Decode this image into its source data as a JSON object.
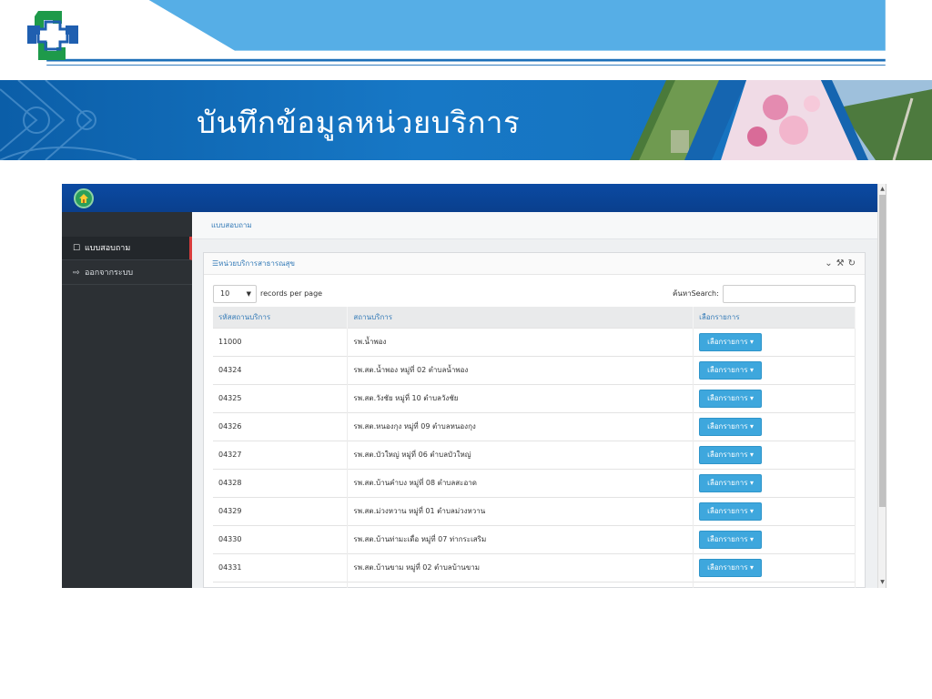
{
  "slide": {
    "title": "บันทึกข้อมูลหน่วยบริการ",
    "colors": {
      "banner_blue": "#1778c6",
      "sidebar_dark": "#2c3034",
      "app_top": "#0b4aa2",
      "button": "#3ea7dd",
      "active_accent": "#d83c3c"
    }
  },
  "app": {
    "home_icon": "home-icon",
    "sidebar": {
      "items": [
        {
          "label": "แบบสอบถาม",
          "icon": "document-icon",
          "active": true
        },
        {
          "label": "ออกจากระบบ",
          "icon": "sign-out-icon",
          "active": false
        }
      ]
    },
    "breadcrumb": "แบบสอบถาม",
    "panel": {
      "title": "หน่วยบริการสาธารณสุข",
      "tools": [
        "chevron-down-icon",
        "wrench-icon",
        "refresh-icon"
      ]
    },
    "table_controls": {
      "page_length": "10",
      "records_per_page_label": "records per page",
      "search_label": "ค้นหาSearch:",
      "search_value": ""
    },
    "table": {
      "headers": [
        "รหัสสถานบริการ",
        "สถานบริการ",
        "เลือกรายการ"
      ],
      "action_label": "เลือกรายการ ▾",
      "rows": [
        {
          "code": "11000",
          "name": "รพ.น้ำพอง"
        },
        {
          "code": "04324",
          "name": "รพ.สต.น้ำพอง หมู่ที่ 02 ตำบลน้ำพอง"
        },
        {
          "code": "04325",
          "name": "รพ.สต.วังชัย หมู่ที่ 10 ตำบลวังชัย"
        },
        {
          "code": "04326",
          "name": "รพ.สต.หนองกุง หมู่ที่ 09 ตำบลหนองกุง"
        },
        {
          "code": "04327",
          "name": "รพ.สต.บัวใหญ่ หมู่ที่ 06 ตำบลบัวใหญ่"
        },
        {
          "code": "04328",
          "name": "รพ.สต.บ้านคำบง หมู่ที่ 08 ตำบลสะอาด"
        },
        {
          "code": "04329",
          "name": "รพ.สต.ม่วงหวาน หมู่ที่ 01 ตำบลม่วงหวาน"
        },
        {
          "code": "04330",
          "name": "รพ.สต.บ้านท่ามะเดื่อ หมู่ที่ 07 ท่ากระเสริม"
        },
        {
          "code": "04331",
          "name": "รพ.สต.บ้านขาม หมู่ที่ 02 ตำบลบ้านขาม"
        }
      ]
    }
  }
}
